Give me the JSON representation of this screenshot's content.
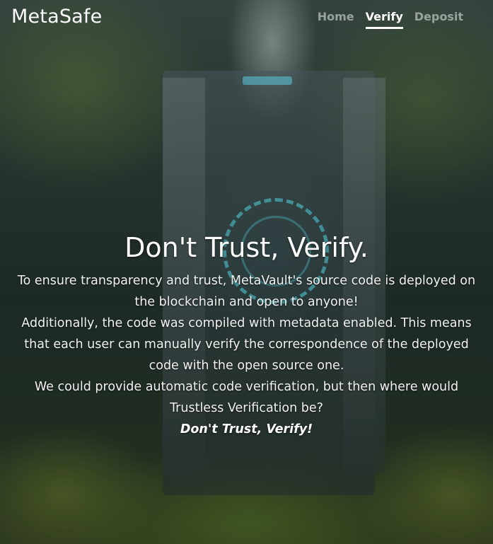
{
  "brand": {
    "name": "MetaSafe"
  },
  "nav": {
    "items": [
      {
        "label": "Home"
      },
      {
        "label": "Verify"
      },
      {
        "label": "Deposit"
      }
    ],
    "active": "Verify"
  },
  "hero": {
    "title": "Don't Trust, Verify.",
    "paragraphs": [
      "To ensure transparency and trust, MetaVault's source code is deployed on the blockchain and open to anyone!",
      "Additionally, the code was compiled with metadata enabled. This means that each user can manually verify the correspondence of the deployed code with the open source one.",
      "We could provide automatic code verification, but then where would Trustless Verification be?"
    ],
    "tagline": "Don't Trust, Verify!"
  },
  "colors": {
    "text": "#ffffff",
    "nav_inactive": "#8a938f",
    "accent_glow": "#50d2dc"
  }
}
